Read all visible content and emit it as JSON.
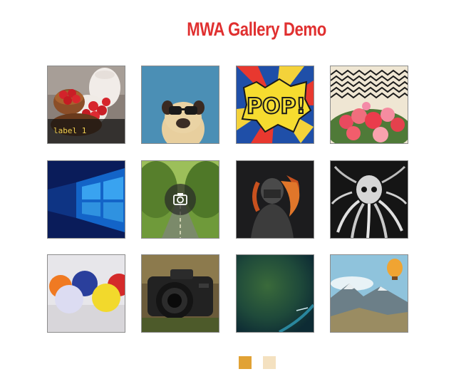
{
  "page": {
    "title": "MWA Gallery Demo"
  },
  "gallery": {
    "items": [
      {
        "name": "strawberries-photo",
        "caption": "label 1"
      },
      {
        "name": "pug-sunglasses-photo"
      },
      {
        "name": "pop-art-photo"
      },
      {
        "name": "chevron-flowers-photo"
      },
      {
        "name": "windows-wallpaper-photo"
      },
      {
        "name": "forest-road-photo"
      },
      {
        "name": "helmet-soldier-photo"
      },
      {
        "name": "octopus-drawing-photo"
      },
      {
        "name": "balls-photo"
      },
      {
        "name": "camera-photo"
      },
      {
        "name": "green-blur-photo"
      },
      {
        "name": "balloon-mountains-photo"
      }
    ]
  },
  "pagination": {
    "pages": 2,
    "active": 1
  },
  "colors": {
    "title": "#e03030",
    "dot_active": "#e1a235",
    "dot_inactive": "#f4e1c0",
    "caption_text": "#f0d050"
  }
}
